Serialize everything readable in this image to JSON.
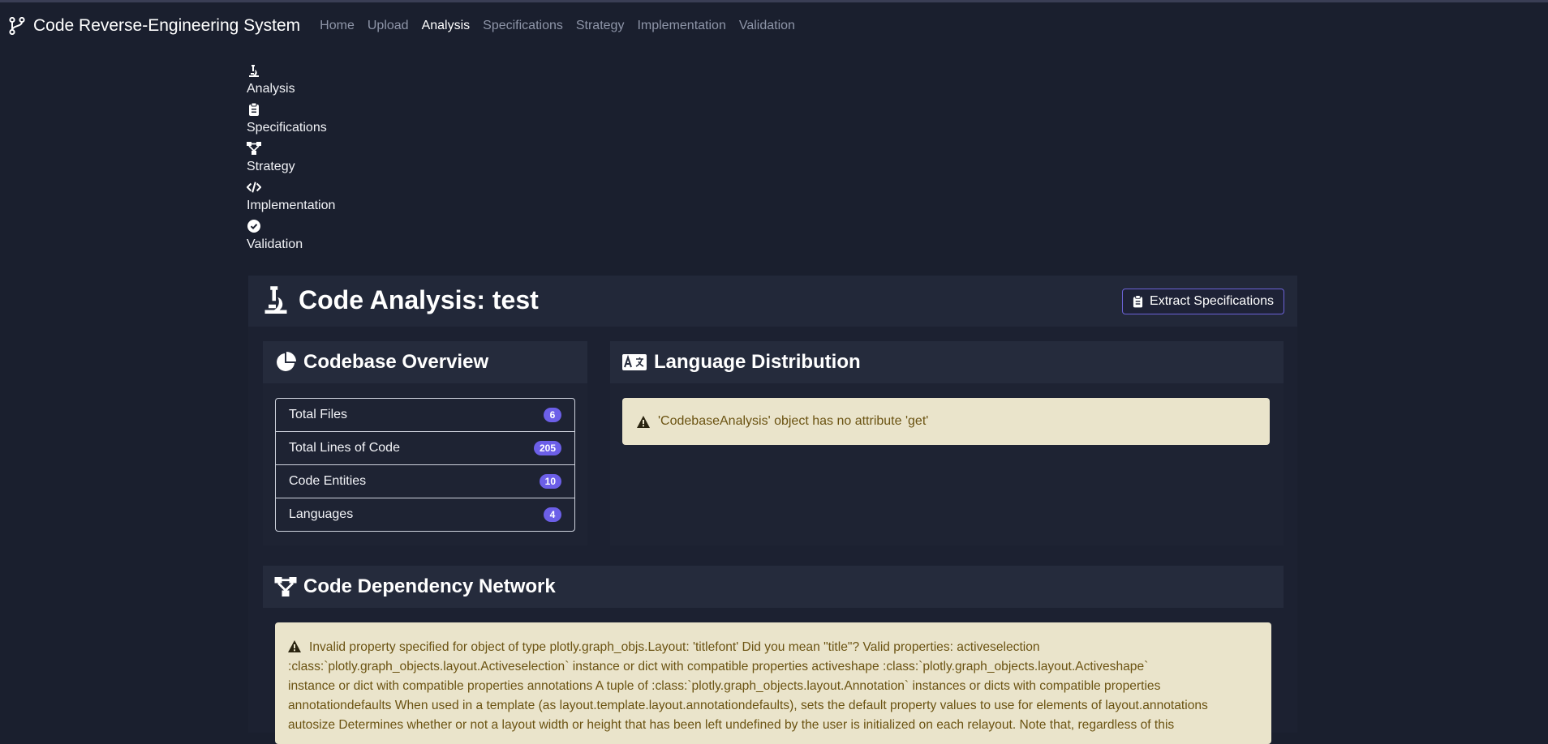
{
  "navbar": {
    "brand": "Code Reverse-Engineering System",
    "links": [
      "Home",
      "Upload",
      "Analysis",
      "Specifications",
      "Strategy",
      "Implementation",
      "Validation"
    ],
    "active": "Analysis"
  },
  "steps": [
    {
      "label": "Analysis",
      "icon": "microscope-icon"
    },
    {
      "label": "Specifications",
      "icon": "clipboard-icon"
    },
    {
      "label": "Strategy",
      "icon": "sitemap-icon"
    },
    {
      "label": "Implementation",
      "icon": "code-icon"
    },
    {
      "label": "Validation",
      "icon": "check-circle-icon"
    }
  ],
  "page": {
    "title": "Code Analysis: test",
    "extract_button": "Extract Specifications"
  },
  "overview": {
    "title": "Codebase Overview",
    "items": [
      {
        "label": "Total Files",
        "value": "6"
      },
      {
        "label": "Total Lines of Code",
        "value": "205"
      },
      {
        "label": "Code Entities",
        "value": "10"
      },
      {
        "label": "Languages",
        "value": "4"
      }
    ]
  },
  "language": {
    "title": "Language Distribution",
    "error": "'CodebaseAnalysis' object has no attribute 'get'"
  },
  "dependency": {
    "title": "Code Dependency Network",
    "error_lines": [
      "Invalid property specified for object of type plotly.graph_objs.Layout: 'titlefont' Did you mean \"title\"? Valid properties: activeselection",
      ":class:`plotly.graph_objects.layout.Activeselection` instance or dict with compatible properties activeshape :class:`plotly.graph_objects.layout.Activeshape`",
      "instance or dict with compatible properties annotations A tuple of :class:`plotly.graph_objects.layout.Annotation` instances or dicts with compatible properties",
      "annotationdefaults When used in a template (as layout.template.layout.annotationdefaults), sets the default property values to use for elements of layout.annotations",
      "autosize Determines whether or not a layout width or height that has been left undefined by the user is initialized on each relayout. Note that, regardless of this"
    ]
  },
  "colors": {
    "background": "#1a1f2e",
    "accent": "#6c5fe8",
    "warning_bg": "#eae4cb",
    "warning_text": "#6b5312"
  }
}
